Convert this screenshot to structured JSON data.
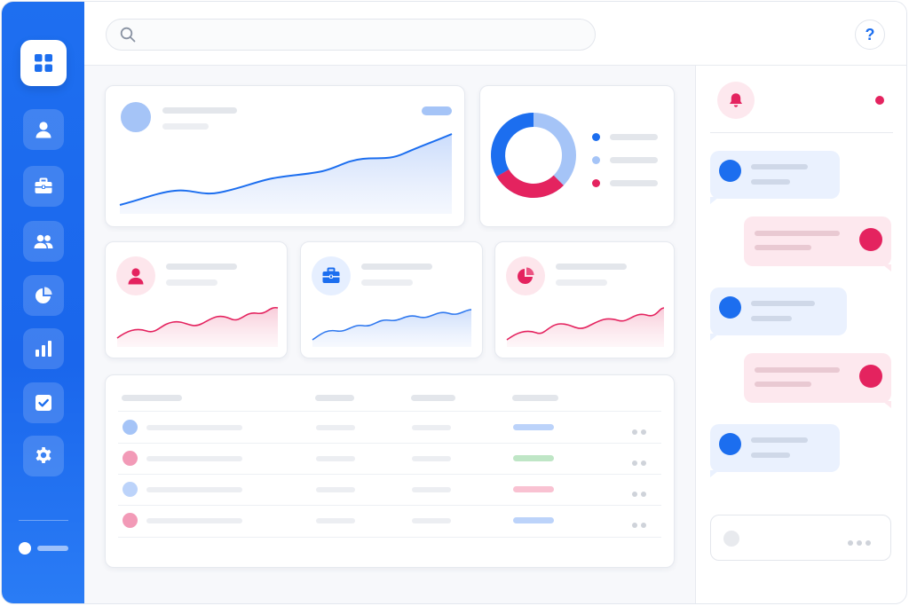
{
  "search": {
    "placeholder": "",
    "value": ""
  },
  "help": {
    "label": "?"
  },
  "colors": {
    "primary": "#1c6eef",
    "light_blue": "#a5c4f7",
    "pink": "#e4235f",
    "light_pink": "#f9d1dc",
    "green": "#bfe6c6"
  },
  "sidebar": {
    "logo_icon": "grid-icon",
    "items": [
      {
        "icon": "user-icon"
      },
      {
        "icon": "briefcase-icon"
      },
      {
        "icon": "users-icon"
      },
      {
        "icon": "pie-chart-icon"
      },
      {
        "icon": "bar-chart-icon"
      },
      {
        "icon": "checkbox-icon"
      },
      {
        "icon": "settings-icon"
      }
    ]
  },
  "stat_cards": [
    {
      "icon": "user-icon",
      "accent": "#e4235f"
    },
    {
      "icon": "briefcase-icon",
      "accent": "#1c6eef"
    },
    {
      "icon": "pie-chart-icon",
      "accent": "#e4235f"
    }
  ],
  "table": {
    "row_status_colors": [
      "#bcd3fa",
      "#bfe6c6",
      "#f9c2d2",
      "#bcd3fa"
    ],
    "row_avatar_colors": [
      "#a5c4f7",
      "#f29ab7",
      "#a5c4f7",
      "#f29ab7"
    ]
  },
  "notifications": {
    "icon": "bell-icon"
  }
}
